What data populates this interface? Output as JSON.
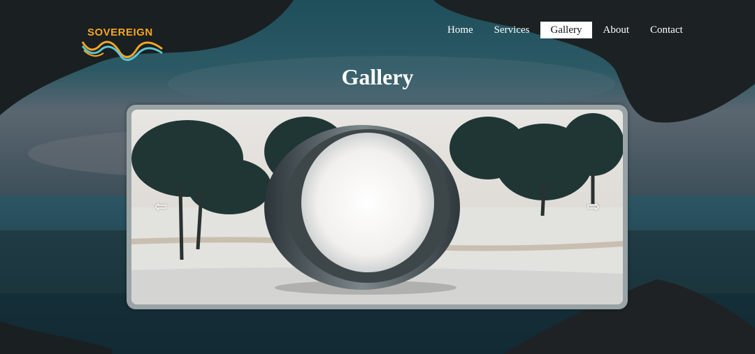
{
  "brand": {
    "logo_text": "SOVEREIGN"
  },
  "nav": {
    "items": [
      {
        "label": "Home"
      },
      {
        "label": "Services"
      },
      {
        "label": "Gallery"
      },
      {
        "label": "About"
      },
      {
        "label": "Contact"
      }
    ],
    "active_label": "Gallery"
  },
  "page": {
    "title": "Gallery"
  },
  "gallery": {
    "prev_glyph": "⇦",
    "next_glyph": "⇨",
    "current_image": "snowy-ring-sculpture"
  },
  "colors": {
    "logo_text": "#f5a623",
    "nav_active_bg": "#ffffff",
    "text": "#ffffff"
  },
  "icons": {
    "prev": "arrow-left-icon",
    "next": "arrow-right-icon",
    "logo": "wave-logo-icon"
  }
}
